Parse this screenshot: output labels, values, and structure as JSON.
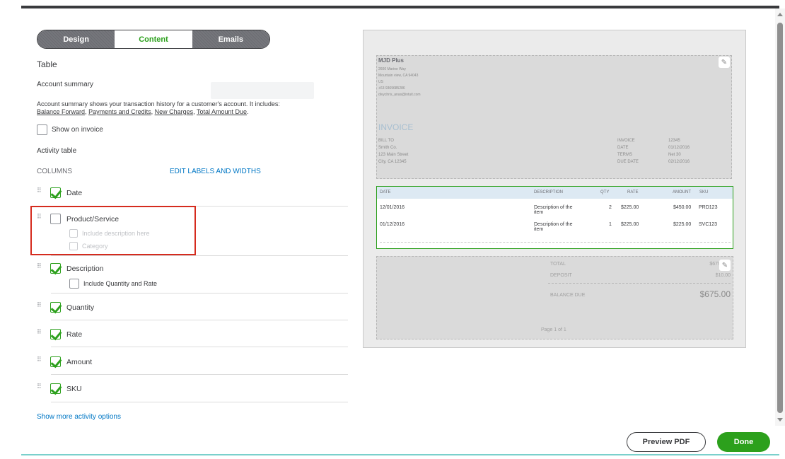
{
  "tabs": [
    {
      "label": "Design"
    },
    {
      "label": "Content"
    },
    {
      "label": "Emails"
    }
  ],
  "section": {
    "title": "Table",
    "account_summary": "Account summary",
    "account_desc_1": "Account summary shows your transaction history for a customer's account. It includes:",
    "account_desc_links": [
      "Balance Forward",
      "Payments and Credits",
      "New Charges",
      "Total Amount Due"
    ],
    "show_on_invoice": "Show on invoice",
    "activity_table": "Activity table",
    "columns_label": "COLUMNS",
    "edit_labels": "EDIT LABELS AND WIDTHS"
  },
  "columns": [
    {
      "label": "Date",
      "checked": true
    },
    {
      "label": "Product/Service",
      "checked": false
    },
    {
      "label": "Description",
      "checked": true
    },
    {
      "label": "Quantity",
      "checked": true
    },
    {
      "label": "Rate",
      "checked": true
    },
    {
      "label": "Amount",
      "checked": true
    },
    {
      "label": "SKU",
      "checked": true
    }
  ],
  "sub_options": {
    "include_description": "Include description here",
    "category": "Category",
    "include_qty_rate": "Include Quantity and Rate"
  },
  "show_more": "Show more activity options",
  "preview": {
    "company": "MJD Plus",
    "address": [
      "2600 Marine Way",
      "Mountain view, CA 94043",
      "US",
      "+63 9369685286",
      "divychris_anas@intuit.com"
    ],
    "invoice_title": "INVOICE",
    "bill_to": [
      "BILL TO",
      "Smith Co.",
      "123 Main Street",
      "City, CA 12345"
    ],
    "meta_labels": [
      "INVOICE",
      "DATE",
      "TERMS",
      "DUE DATE"
    ],
    "meta_values": [
      "12345",
      "01/12/2016",
      "Net 30",
      "02/12/2016"
    ],
    "table_headers": [
      "DATE",
      "DESCRIPTION",
      "QTY",
      "RATE",
      "AMOUNT",
      "SKU"
    ],
    "rows": [
      {
        "date": "12/01/2016",
        "desc_1": "Description of the",
        "desc_2": "item",
        "qty": "2",
        "rate": "$225.00",
        "amount": "$450.00",
        "sku": "PRD123"
      },
      {
        "date": "01/12/2016",
        "desc_1": "Description of the",
        "desc_2": "item",
        "qty": "1",
        "rate": "$225.00",
        "amount": "$225.00",
        "sku": "SVC123"
      }
    ],
    "total_label": "TOTAL",
    "total_value": "$67!",
    "deposit_label": "DEPOSIT",
    "deposit_value": "$10.00",
    "balance_label": "BALANCE DUE",
    "balance_value": "$675.00",
    "page": "Page 1 of 1"
  },
  "buttons": {
    "preview_pdf": "Preview PDF",
    "done": "Done"
  },
  "colors": {
    "accent_green": "#2ca01c",
    "link_blue": "#0077c5",
    "highlight_red": "#d52b1e"
  }
}
